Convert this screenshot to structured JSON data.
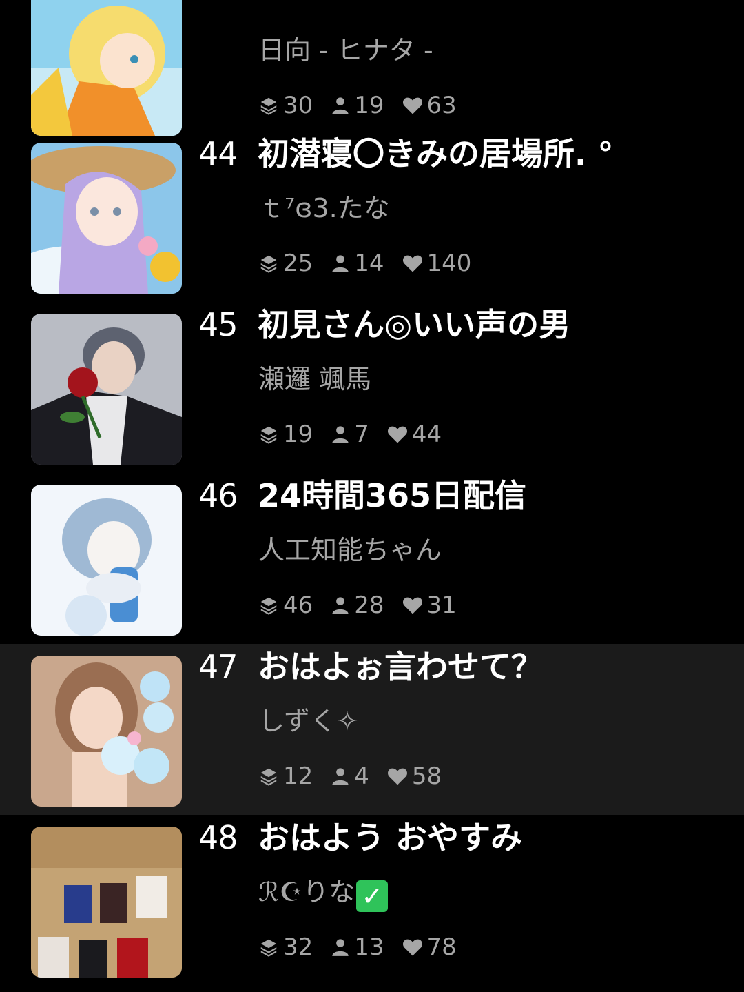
{
  "rooms": [
    {
      "rank": "",
      "title": "",
      "host": "日向 - ヒナタ -",
      "stats": {
        "layers": "30",
        "listeners": "19",
        "likes": "63"
      }
    },
    {
      "rank": "44",
      "title": "初潜寝〇きみの居場所. °",
      "host": "ｔ⁷ɞ3.たな",
      "stats": {
        "layers": "25",
        "listeners": "14",
        "likes": "140"
      }
    },
    {
      "rank": "45",
      "title": "初見さん◎いい声の男",
      "host": "瀬邏 颯馬",
      "stats": {
        "layers": "19",
        "listeners": "7",
        "likes": "44"
      }
    },
    {
      "rank": "46",
      "title": "24時間365日配信",
      "host": "人工知能ちゃん",
      "stats": {
        "layers": "46",
        "listeners": "28",
        "likes": "31"
      }
    },
    {
      "rank": "47",
      "title": "おはよぉ言わせて？",
      "host": "しずく✧",
      "stats": {
        "layers": "12",
        "listeners": "4",
        "likes": "58"
      }
    },
    {
      "rank": "48",
      "title": "おはよう おやすみ",
      "host": "ℛ☪りな",
      "stats": {
        "layers": "32",
        "listeners": "13",
        "likes": "78"
      }
    }
  ],
  "icons": {
    "layers": "layers-icon",
    "listeners": "person-icon",
    "likes": "heart-icon"
  },
  "colors": {
    "background": "#000000",
    "highlight_row": "#1b1b1b",
    "muted_text": "#a6a6a6",
    "check_badge": "#2fc35a"
  }
}
